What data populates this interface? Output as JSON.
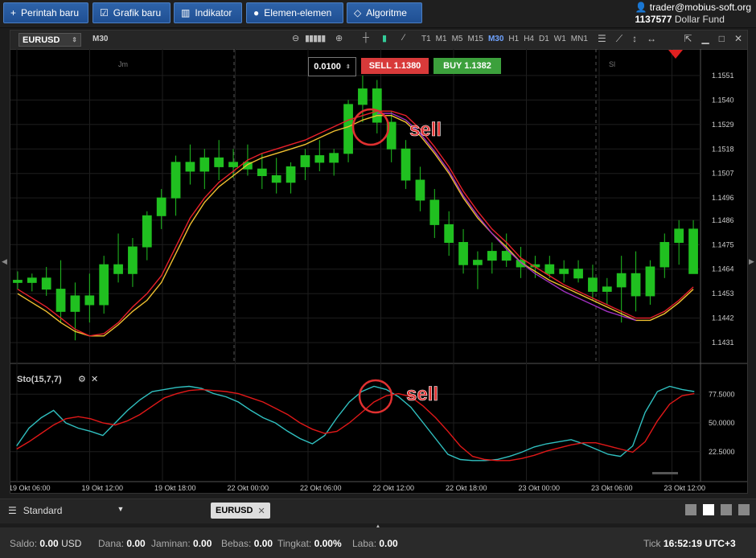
{
  "topbar": {
    "buttons": [
      {
        "icon": "+",
        "label": "Perintah baru"
      },
      {
        "icon": "☑",
        "label": "Grafik baru"
      },
      {
        "icon": "▥",
        "label": "Indikator"
      },
      {
        "icon": "●",
        "label": "Elemen-elemen"
      },
      {
        "icon": "◇",
        "label": "Algoritme"
      }
    ],
    "account_user": "trader@mobius-soft.org",
    "account_number": "1137577",
    "account_fund": "Dollar Fund"
  },
  "chart_toolbar": {
    "symbol": "EURUSD",
    "timeframe": "M30",
    "timeframes": [
      "T1",
      "M1",
      "M5",
      "M15",
      "M30",
      "H1",
      "H4",
      "D1",
      "W1",
      "MN1"
    ],
    "active_timeframe": "M30"
  },
  "trade": {
    "lot": "0.0100",
    "sell_label": "SELL 1.1380",
    "buy_label": "BUY 1.1382"
  },
  "session_labels": [
    "Jm",
    "Sl"
  ],
  "annotations": {
    "sell_main": "sell",
    "sell_osc": "sell"
  },
  "indicator": {
    "name": "Sto(15,7,7)"
  },
  "chart_data": [
    {
      "type": "candlestick",
      "symbol": "EURUSD",
      "ylim": [
        1.1422,
        1.156
      ],
      "yticks": [
        "1.1551",
        "1.1540",
        "1.1529",
        "1.1518",
        "1.1507",
        "1.1496",
        "1.1486",
        "1.1475",
        "1.1464",
        "1.1453",
        "1.1442",
        "1.1431"
      ],
      "series": [
        {
          "name": "MA fast",
          "color": "#f0c030",
          "values": [
            1.1453,
            1.1449,
            1.1445,
            1.144,
            1.1436,
            1.1434,
            1.1434,
            1.1439,
            1.1445,
            1.145,
            1.1458,
            1.1471,
            1.1484,
            1.1494,
            1.1501,
            1.1506,
            1.1511,
            1.1514,
            1.1516,
            1.1518,
            1.152,
            1.1523,
            1.1526,
            1.1528,
            1.1531,
            1.1533,
            1.1533,
            1.153,
            1.1524,
            1.1516,
            1.1507,
            1.1496,
            1.1487,
            1.148,
            1.1474,
            1.1467,
            1.1463,
            1.1459,
            1.1456,
            1.1453,
            1.145,
            1.1447,
            1.1444,
            1.1441,
            1.1441,
            1.1444,
            1.1449,
            1.1455
          ]
        },
        {
          "name": "MA slow",
          "color": "#e8202a",
          "values": [
            1.1455,
            1.1451,
            1.1447,
            1.1442,
            1.1437,
            1.1434,
            1.1435,
            1.144,
            1.1447,
            1.1453,
            1.1461,
            1.1474,
            1.1487,
            1.1496,
            1.1503,
            1.1508,
            1.1513,
            1.1516,
            1.1518,
            1.152,
            1.1522,
            1.1525,
            1.1528,
            1.1531,
            1.1533,
            1.1535,
            1.1535,
            1.1533,
            1.1527,
            1.1519,
            1.151,
            1.1499,
            1.149,
            1.1482,
            1.1476,
            1.1469,
            1.1465,
            1.1461,
            1.1457,
            1.1454,
            1.1451,
            1.1448,
            1.1445,
            1.1442,
            1.1442,
            1.1445,
            1.145,
            1.1456
          ]
        },
        {
          "name": "MA purple",
          "color": "#a030c0",
          "values": [
            null,
            null,
            null,
            null,
            null,
            null,
            null,
            null,
            null,
            null,
            null,
            null,
            null,
            null,
            null,
            null,
            null,
            null,
            null,
            null,
            null,
            null,
            null,
            null,
            null,
            1.1534,
            1.1534,
            1.1531,
            1.1525,
            1.1517,
            1.1508,
            1.1497,
            1.1488,
            1.148,
            1.1473,
            1.1467,
            1.1462,
            1.1458,
            1.1454,
            1.1451,
            1.1448,
            1.1445,
            1.1443,
            1.1441,
            null,
            null,
            null,
            null
          ]
        }
      ],
      "candles": [
        {
          "o": 1.1459,
          "h": 1.1463,
          "l": 1.1455,
          "c": 1.1458
        },
        {
          "o": 1.1458,
          "h": 1.1462,
          "l": 1.1454,
          "c": 1.146
        },
        {
          "o": 1.146,
          "h": 1.1465,
          "l": 1.1452,
          "c": 1.1455
        },
        {
          "o": 1.1455,
          "h": 1.1468,
          "l": 1.144,
          "c": 1.1445
        },
        {
          "o": 1.1445,
          "h": 1.1458,
          "l": 1.1432,
          "c": 1.1452
        },
        {
          "o": 1.1452,
          "h": 1.1462,
          "l": 1.144,
          "c": 1.1448
        },
        {
          "o": 1.1448,
          "h": 1.147,
          "l": 1.1444,
          "c": 1.1466
        },
        {
          "o": 1.1466,
          "h": 1.148,
          "l": 1.1458,
          "c": 1.1462
        },
        {
          "o": 1.1462,
          "h": 1.1478,
          "l": 1.1456,
          "c": 1.1474
        },
        {
          "o": 1.1474,
          "h": 1.149,
          "l": 1.1468,
          "c": 1.1488
        },
        {
          "o": 1.1488,
          "h": 1.15,
          "l": 1.1482,
          "c": 1.1496
        },
        {
          "o": 1.1496,
          "h": 1.1515,
          "l": 1.1488,
          "c": 1.1512
        },
        {
          "o": 1.1512,
          "h": 1.152,
          "l": 1.1502,
          "c": 1.1508
        },
        {
          "o": 1.1508,
          "h": 1.1518,
          "l": 1.15,
          "c": 1.1514
        },
        {
          "o": 1.1514,
          "h": 1.1522,
          "l": 1.1504,
          "c": 1.151
        },
        {
          "o": 1.151,
          "h": 1.1518,
          "l": 1.1505,
          "c": 1.1512
        },
        {
          "o": 1.1512,
          "h": 1.152,
          "l": 1.1506,
          "c": 1.1509
        },
        {
          "o": 1.1509,
          "h": 1.1516,
          "l": 1.15,
          "c": 1.1506
        },
        {
          "o": 1.1506,
          "h": 1.1514,
          "l": 1.1498,
          "c": 1.1503
        },
        {
          "o": 1.1503,
          "h": 1.1512,
          "l": 1.1498,
          "c": 1.151
        },
        {
          "o": 1.151,
          "h": 1.1518,
          "l": 1.1504,
          "c": 1.1515
        },
        {
          "o": 1.1515,
          "h": 1.1522,
          "l": 1.1508,
          "c": 1.1512
        },
        {
          "o": 1.1512,
          "h": 1.1518,
          "l": 1.1506,
          "c": 1.1516
        },
        {
          "o": 1.1516,
          "h": 1.154,
          "l": 1.1512,
          "c": 1.1538
        },
        {
          "o": 1.1538,
          "h": 1.1551,
          "l": 1.153,
          "c": 1.1545
        },
        {
          "o": 1.1545,
          "h": 1.1549,
          "l": 1.1525,
          "c": 1.153
        },
        {
          "o": 1.153,
          "h": 1.1535,
          "l": 1.1512,
          "c": 1.1518
        },
        {
          "o": 1.1518,
          "h": 1.1522,
          "l": 1.15,
          "c": 1.1504
        },
        {
          "o": 1.1504,
          "h": 1.151,
          "l": 1.149,
          "c": 1.1495
        },
        {
          "o": 1.1495,
          "h": 1.15,
          "l": 1.1478,
          "c": 1.1484
        },
        {
          "o": 1.1484,
          "h": 1.149,
          "l": 1.147,
          "c": 1.1476
        },
        {
          "o": 1.1476,
          "h": 1.1482,
          "l": 1.1462,
          "c": 1.1466
        },
        {
          "o": 1.1466,
          "h": 1.1472,
          "l": 1.1455,
          "c": 1.1468
        },
        {
          "o": 1.1468,
          "h": 1.1476,
          "l": 1.1462,
          "c": 1.1472
        },
        {
          "o": 1.1472,
          "h": 1.148,
          "l": 1.1465,
          "c": 1.1468
        },
        {
          "o": 1.1468,
          "h": 1.1474,
          "l": 1.146,
          "c": 1.1465
        },
        {
          "o": 1.1465,
          "h": 1.147,
          "l": 1.146,
          "c": 1.1466
        },
        {
          "o": 1.1466,
          "h": 1.147,
          "l": 1.146,
          "c": 1.1462
        },
        {
          "o": 1.1462,
          "h": 1.1468,
          "l": 1.1458,
          "c": 1.1464
        },
        {
          "o": 1.1464,
          "h": 1.1468,
          "l": 1.1458,
          "c": 1.146
        },
        {
          "o": 1.146,
          "h": 1.1466,
          "l": 1.145,
          "c": 1.1454
        },
        {
          "o": 1.1454,
          "h": 1.146,
          "l": 1.1448,
          "c": 1.1456
        },
        {
          "o": 1.1456,
          "h": 1.147,
          "l": 1.144,
          "c": 1.1462
        },
        {
          "o": 1.1462,
          "h": 1.1472,
          "l": 1.1445,
          "c": 1.1452
        },
        {
          "o": 1.1452,
          "h": 1.1468,
          "l": 1.1448,
          "c": 1.1465
        },
        {
          "o": 1.1465,
          "h": 1.148,
          "l": 1.146,
          "c": 1.1476
        },
        {
          "o": 1.1476,
          "h": 1.1486,
          "l": 1.1466,
          "c": 1.1482
        },
        {
          "o": 1.1482,
          "h": 1.1486,
          "l": 1.1462,
          "c": 1.1462
        }
      ]
    },
    {
      "type": "line",
      "name": "Sto(15,7,7)",
      "ylim": [
        0,
        100
      ],
      "yticks": [
        "77.5000",
        "50.0000",
        "22.5000"
      ],
      "series": [
        {
          "name": "%K",
          "color": "#30c0c0",
          "values": [
            28,
            45,
            55,
            62,
            50,
            45,
            42,
            38,
            50,
            62,
            72,
            80,
            82,
            84,
            85,
            83,
            78,
            75,
            70,
            62,
            55,
            50,
            42,
            35,
            30,
            38,
            55,
            70,
            80,
            85,
            82,
            75,
            65,
            50,
            35,
            20,
            15,
            14,
            14,
            15,
            18,
            22,
            27,
            30,
            32,
            34,
            30,
            25,
            20,
            18,
            28,
            60,
            80,
            85,
            82,
            80
          ]
        },
        {
          "name": "%D",
          "color": "#e01818",
          "values": [
            25,
            32,
            40,
            48,
            54,
            56,
            54,
            50,
            48,
            52,
            58,
            66,
            74,
            78,
            81,
            82,
            81,
            80,
            78,
            74,
            70,
            64,
            58,
            50,
            44,
            40,
            42,
            50,
            60,
            70,
            76,
            78,
            75,
            66,
            55,
            42,
            28,
            18,
            15,
            14,
            14,
            16,
            19,
            23,
            26,
            29,
            31,
            31,
            28,
            25,
            22,
            32,
            52,
            68,
            76,
            78
          ]
        }
      ],
      "xlabels": [
        "19 Okt 06:00",
        "19 Okt 12:00",
        "19 Okt 18:00",
        "22 Okt 00:00",
        "22 Okt 06:00",
        "22 Okt 12:00",
        "22 Okt 18:00",
        "23 Okt 00:00",
        "23 Okt 06:00",
        "23 Okt 12:00"
      ]
    }
  ],
  "bottom": {
    "layout_name": "Standard",
    "tab": "EURUSD"
  },
  "status": {
    "saldo_label": "Saldo:",
    "saldo_value": "0.00",
    "saldo_cur": "USD",
    "dana_label": "Dana:",
    "dana_value": "0.00",
    "jaminan_label": "Jaminan:",
    "jaminan_value": "0.00",
    "bebas_label": "Bebas:",
    "bebas_value": "0.00",
    "tingkat_label": "Tingkat:",
    "tingkat_value": "0.00%",
    "laba_label": "Laba:",
    "laba_value": "0.00",
    "tick_label": "Tick",
    "tick_time": "16:52:19",
    "utc": "UTC+3"
  }
}
